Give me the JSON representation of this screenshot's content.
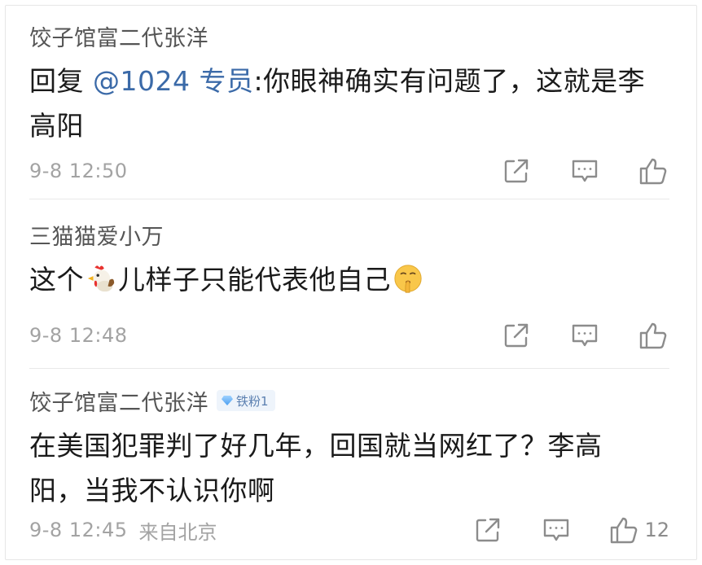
{
  "comments": [
    {
      "username": "饺子馆富二代张洋",
      "reply_prefix": "回复",
      "mention": "@1024 专员",
      "text_line1": ":你眼神确实有问题了，这就是李",
      "text_line2": "高阳",
      "time": "9-8 12:50"
    },
    {
      "username": "三猫猫爱小万",
      "text_part1": "这个",
      "emoji1": "rooster-emoji",
      "text_part2": "儿样子只能代表他自己",
      "emoji2": "shushing-face-emoji",
      "time": "9-8 12:48"
    },
    {
      "username": "饺子馆富二代张洋",
      "badge": "铁粉1",
      "text_line1": "在美国犯罪判了好几年，回国就当网红了？李高",
      "text_line2": "阳，当我不认识你啊",
      "time": "9-8 12:45",
      "source": "来自北京",
      "likes": "12"
    }
  ],
  "icons": {
    "share": "share-icon",
    "comment": "comment-icon",
    "like": "thumbs-up-icon"
  },
  "colors": {
    "mention": "#3b6aa8",
    "meta": "#a3a3a3",
    "icon": "#8c8c8c"
  }
}
